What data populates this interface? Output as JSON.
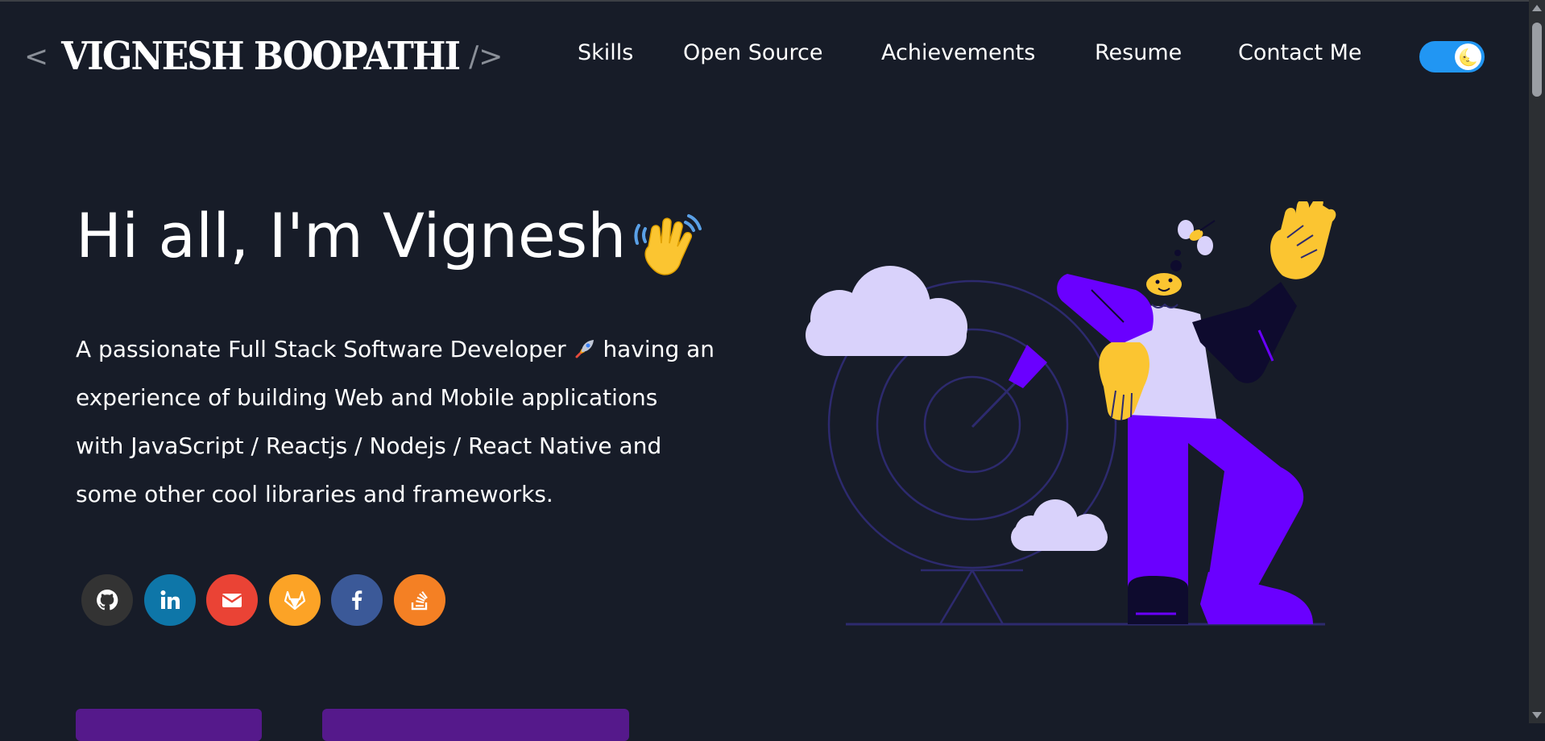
{
  "header": {
    "logo_open": "<",
    "logo_name": "VIGNESH BOOPATHI",
    "logo_close": "/>",
    "nav": [
      {
        "label": "Skills"
      },
      {
        "label": "Open Source"
      },
      {
        "label": "Achievements"
      },
      {
        "label": "Resume"
      },
      {
        "label": "Contact Me"
      }
    ],
    "theme_toggle": {
      "state": "dark",
      "icon": "moon-emoji"
    }
  },
  "hero": {
    "greeting": "Hi all, I'm Vignesh",
    "greeting_icon": "waving-hand-emoji",
    "description_lines": [
      "A passionate Full Stack Software Developer",
      "having an",
      "experience of building Web and Mobile applications",
      "with JavaScript / Reactjs / Nodejs / React Native and",
      "some other cool libraries and frameworks."
    ],
    "description_icon": "rocket-emoji",
    "socials": [
      {
        "icon": "github-icon",
        "color": "#333333"
      },
      {
        "icon": "linkedin-icon",
        "color": "#0e76a8"
      },
      {
        "icon": "email-icon",
        "color": "#ea4335"
      },
      {
        "icon": "gitlab-icon",
        "color": "#fca326"
      },
      {
        "icon": "facebook-icon",
        "color": "#3b5998"
      },
      {
        "icon": "stackoverflow-icon",
        "color": "#f48024"
      }
    ]
  },
  "colors": {
    "background": "#171c28",
    "accent_purple": "#6a00ff",
    "button_purple": "#55198b",
    "toggle_blue": "#2196f3"
  }
}
